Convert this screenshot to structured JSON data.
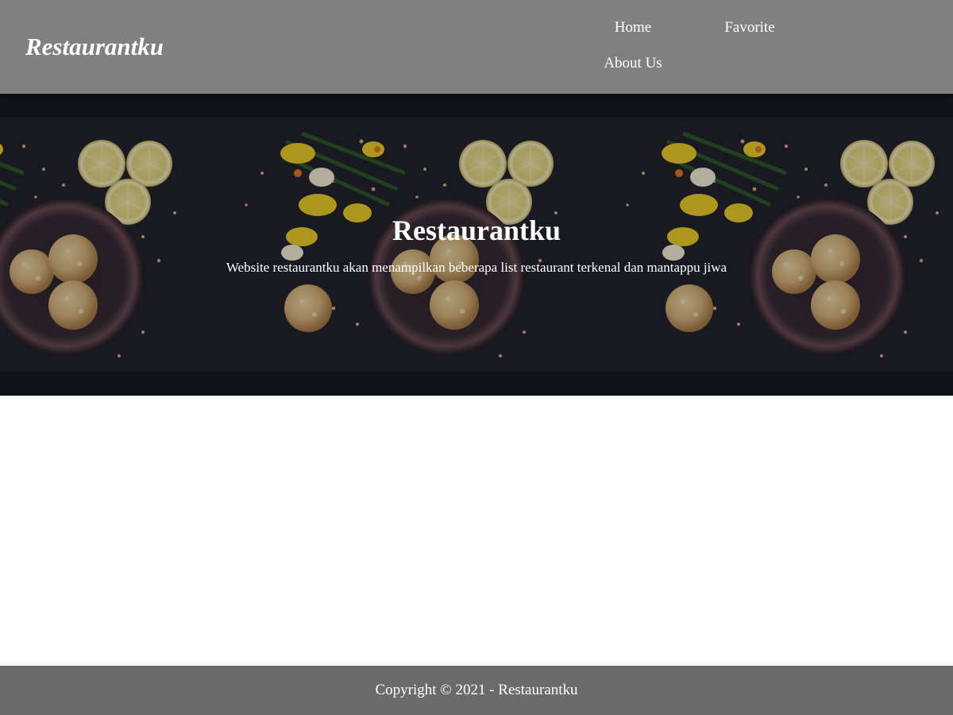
{
  "header": {
    "brand": "Restaurantku",
    "nav": {
      "home": "Home",
      "favorite": "Favorite",
      "about": "About Us"
    },
    "background_color": "#808080"
  },
  "hero": {
    "title": "Restaurantku",
    "description": "Website restaurantku akan menampilkan beberapa list restaurant terkenal dan mantappu jiwa",
    "image": "food-flatlay-image"
  },
  "footer": {
    "text": "Copyright © 2021 - Restaurantku",
    "background_color": "#6b6b6b"
  }
}
